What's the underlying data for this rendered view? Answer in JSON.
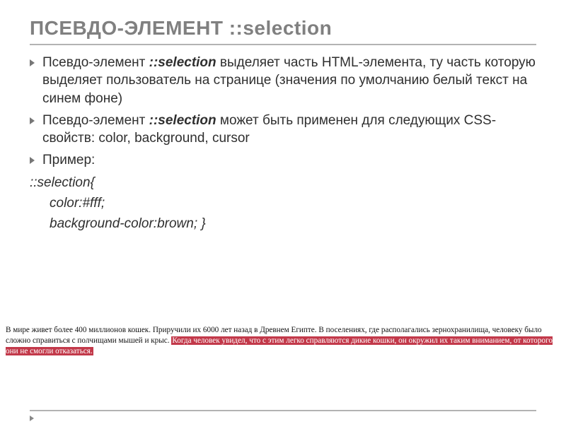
{
  "title_prefix": "ПСЕВДО-ЭЛЕМЕНТ  ",
  "title_selector": "::selection",
  "bullets": {
    "b1_a": "Псевдо-элемент ",
    "b1_sel": "::selection",
    "b1_b": " выделяет часть HTML-элемента, ту часть которую выделяет пользователь на странице (значения по умолчанию белый текст на синем фоне)",
    "b2_a": "Псевдо-элемент  ",
    "b2_sel": "::selection",
    "b2_b": " может быть применен для следующих CSS-свойств: color, background, cursor",
    "b3": "Пример:"
  },
  "code": {
    "l1": "::selection{",
    "l2": "color:#fff;",
    "l3": "background-color:brown; }"
  },
  "example": {
    "plain": "В мире живет более 400 миллионов кошек. Приручили их 6000 лет назад в Древнем Египте. В поселениях, где располагались зернохранилища, человеку было сложно справиться с полчищами мышей и крыс. ",
    "hl": "Когда человек увидел, что с этим легко справляются дикие кошки, он окружил их таким вниманием, от которого они не смогли отказаться."
  }
}
